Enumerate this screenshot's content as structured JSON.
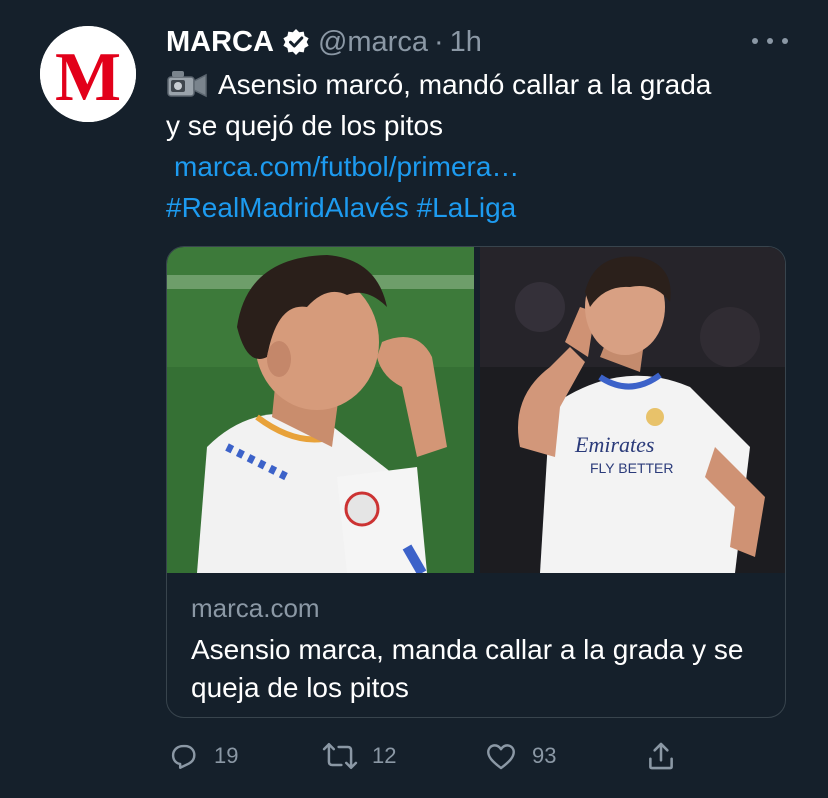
{
  "tweet": {
    "author_name": "MARCA",
    "handle": "@marca",
    "separator": "·",
    "time": "1h",
    "text_line1": "Asensio marcó, mandó callar a la grada",
    "text_line2": "y se quejó de los pitos",
    "link": "marca.com/futbol/primera…",
    "hashtags": "#RealMadridAlavés #LaLiga",
    "avatar_logo": "M"
  },
  "card": {
    "domain": "marca.com",
    "title": "Asensio marca, manda callar a la grada y se queja de los pitos",
    "image_left": "photo: player in white kit biting fingers",
    "image_right": "photo: player making shush gesture"
  },
  "actions": {
    "replies": "19",
    "retweets": "12",
    "likes": "93"
  },
  "colors": {
    "background": "#15202b",
    "link": "#1d9bf0",
    "muted": "#8b98a5",
    "brand_red": "#e2001a"
  },
  "icons": [
    "verified-badge-icon",
    "more-options-icon",
    "video-camera-icon",
    "reply-icon",
    "retweet-icon",
    "like-icon",
    "share-icon"
  ]
}
